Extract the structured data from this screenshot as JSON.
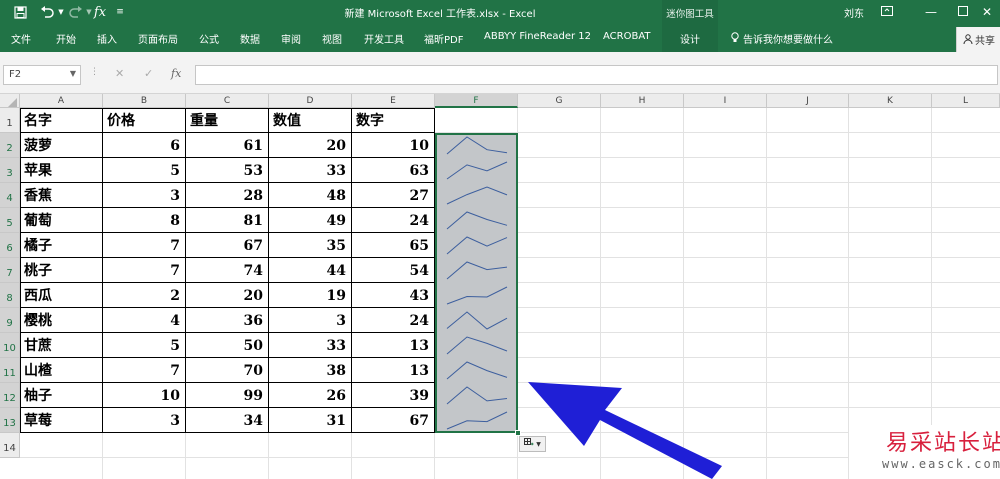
{
  "titlebar": {
    "title": "新建 Microsoft Excel 工作表.xlsx  -  Excel",
    "context_tab_group": "迷你图工具",
    "user": "刘东"
  },
  "ribbon": {
    "tabs": [
      "文件",
      "开始",
      "插入",
      "页面布局",
      "公式",
      "数据",
      "审阅",
      "视图",
      "开发工具",
      "福昕PDF",
      "ABBYY FineReader 12",
      "ACROBAT"
    ],
    "design_tab": "设计",
    "tell_me": "告诉我你想要做什么",
    "share": "共享"
  },
  "formula_bar": {
    "name_box": "F2",
    "formula": ""
  },
  "sheet": {
    "columns": [
      "A",
      "B",
      "C",
      "D",
      "E",
      "F",
      "G",
      "H",
      "I",
      "J",
      "K",
      "L"
    ],
    "rows": [
      "1",
      "2",
      "3",
      "4",
      "5",
      "6",
      "7",
      "8",
      "9",
      "10",
      "11",
      "12",
      "13",
      "14"
    ],
    "headers": [
      "名字",
      "价格",
      "重量",
      "数值",
      "数字"
    ],
    "data": [
      [
        "菠萝",
        "6",
        "61",
        "20",
        "10"
      ],
      [
        "苹果",
        "5",
        "53",
        "33",
        "63"
      ],
      [
        "香蕉",
        "3",
        "28",
        "48",
        "27"
      ],
      [
        "葡萄",
        "8",
        "81",
        "49",
        "24"
      ],
      [
        "橘子",
        "7",
        "67",
        "35",
        "65"
      ],
      [
        "桃子",
        "7",
        "74",
        "44",
        "54"
      ],
      [
        "西瓜",
        "2",
        "20",
        "19",
        "43"
      ],
      [
        "樱桃",
        "4",
        "36",
        "3",
        "24"
      ],
      [
        "甘蔗",
        "5",
        "50",
        "33",
        "13"
      ],
      [
        "山楂",
        "7",
        "70",
        "38",
        "13"
      ],
      [
        "柚子",
        "10",
        "99",
        "26",
        "39"
      ],
      [
        "草莓",
        "3",
        "34",
        "31",
        "67"
      ]
    ],
    "selection": "F2:F13",
    "accent_color": "#217346",
    "arrow_color": "#1f1fd6"
  },
  "watermark": {
    "text": "易采站长站",
    "url": "www.easck.com"
  }
}
